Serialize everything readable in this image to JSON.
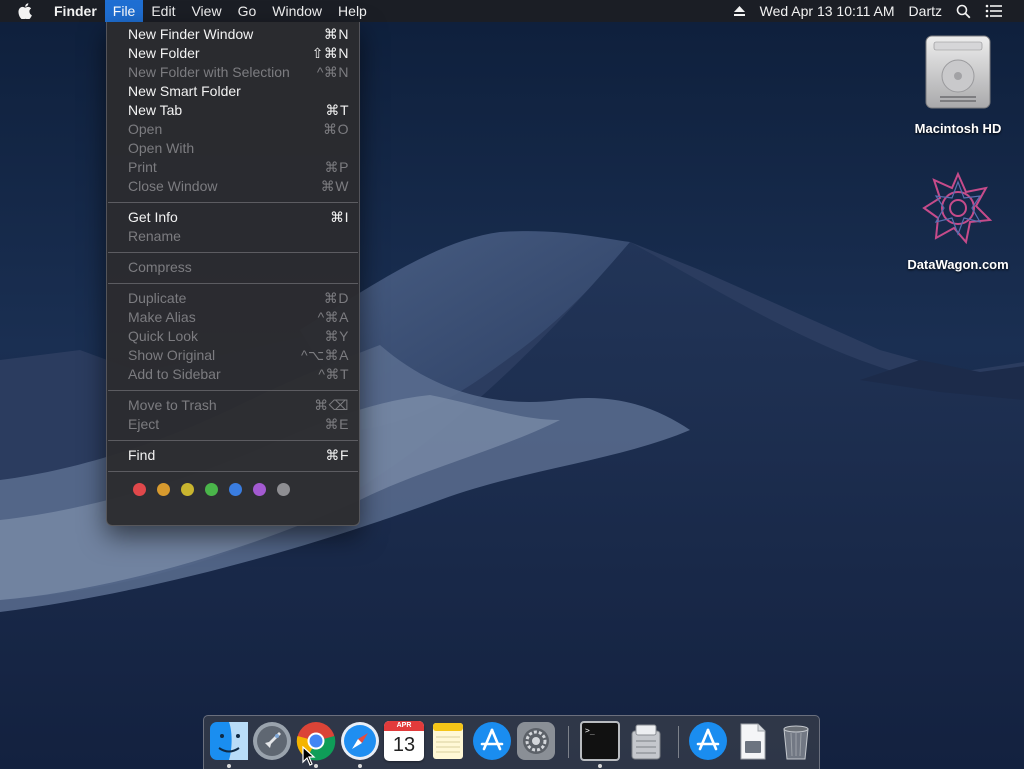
{
  "menubar": {
    "app_name": "Finder",
    "menus": [
      "File",
      "Edit",
      "View",
      "Go",
      "Window",
      "Help"
    ],
    "active_menu": "File",
    "clock": "Wed Apr 13  10:11 AM",
    "user": "Dartz"
  },
  "file_menu": {
    "items": [
      {
        "label": "New Finder Window",
        "shortcut": "⌘N",
        "enabled": true
      },
      {
        "label": "New Folder",
        "shortcut": "⇧⌘N",
        "enabled": true
      },
      {
        "label": "New Folder with Selection",
        "shortcut": "^⌘N",
        "enabled": false
      },
      {
        "label": "New Smart Folder",
        "shortcut": "",
        "enabled": true
      },
      {
        "label": "New Tab",
        "shortcut": "⌘T",
        "enabled": true
      },
      {
        "label": "Open",
        "shortcut": "⌘O",
        "enabled": false
      },
      {
        "label": "Open With",
        "shortcut": "",
        "enabled": false
      },
      {
        "label": "Print",
        "shortcut": "⌘P",
        "enabled": false
      },
      {
        "label": "Close Window",
        "shortcut": "⌘W",
        "enabled": false
      },
      {
        "label": "Get Info",
        "shortcut": "⌘I",
        "enabled": true
      },
      {
        "label": "Rename",
        "shortcut": "",
        "enabled": false
      },
      {
        "label": "Compress",
        "shortcut": "",
        "enabled": false
      },
      {
        "label": "Duplicate",
        "shortcut": "⌘D",
        "enabled": false
      },
      {
        "label": "Make Alias",
        "shortcut": "^⌘A",
        "enabled": false
      },
      {
        "label": "Quick Look",
        "shortcut": "⌘Y",
        "enabled": false
      },
      {
        "label": "Show Original",
        "shortcut": "^⌥⌘A",
        "enabled": false
      },
      {
        "label": "Add to Sidebar",
        "shortcut": "^⌘T",
        "enabled": false
      },
      {
        "label": "Move to Trash",
        "shortcut": "⌘⌫",
        "enabled": false
      },
      {
        "label": "Eject",
        "shortcut": "⌘E",
        "enabled": false
      },
      {
        "label": "Find",
        "shortcut": "⌘F",
        "enabled": true
      }
    ],
    "tag_colors": [
      "#e0484b",
      "#d79a2e",
      "#c9b52f",
      "#4ab54a",
      "#3a7de0",
      "#a35ad1",
      "#8e8e92"
    ]
  },
  "desktop": {
    "icons": [
      {
        "label": "Macintosh HD",
        "icon": "hard-drive-icon"
      },
      {
        "label": "DataWagon.com",
        "icon": "datawagon-logo-icon"
      }
    ]
  },
  "dock": {
    "apps": [
      {
        "name": "Finder",
        "icon": "finder-icon",
        "running": true
      },
      {
        "name": "Launchpad",
        "icon": "launchpad-icon",
        "running": false
      },
      {
        "name": "Google Chrome",
        "icon": "chrome-icon",
        "running": true
      },
      {
        "name": "Safari",
        "icon": "safari-icon",
        "running": true
      },
      {
        "name": "Calendar",
        "icon": "calendar-icon",
        "running": false,
        "month": "APR",
        "day": "13"
      },
      {
        "name": "Notes",
        "icon": "notes-icon",
        "running": false
      },
      {
        "name": "App Store",
        "icon": "app-store-icon",
        "running": false
      },
      {
        "name": "System Preferences",
        "icon": "system-preferences-icon",
        "running": false
      },
      {
        "name": "Terminal",
        "icon": "terminal-icon",
        "running": true,
        "prompt": ">_"
      },
      {
        "name": "Disk Utility",
        "icon": "disk-utility-icon",
        "running": false
      },
      {
        "name": "Downloads",
        "icon": "downloads-stack-icon",
        "running": false
      },
      {
        "name": "Document",
        "icon": "document-stack-icon",
        "running": false
      },
      {
        "name": "Trash",
        "icon": "trash-icon",
        "running": false
      }
    ]
  }
}
